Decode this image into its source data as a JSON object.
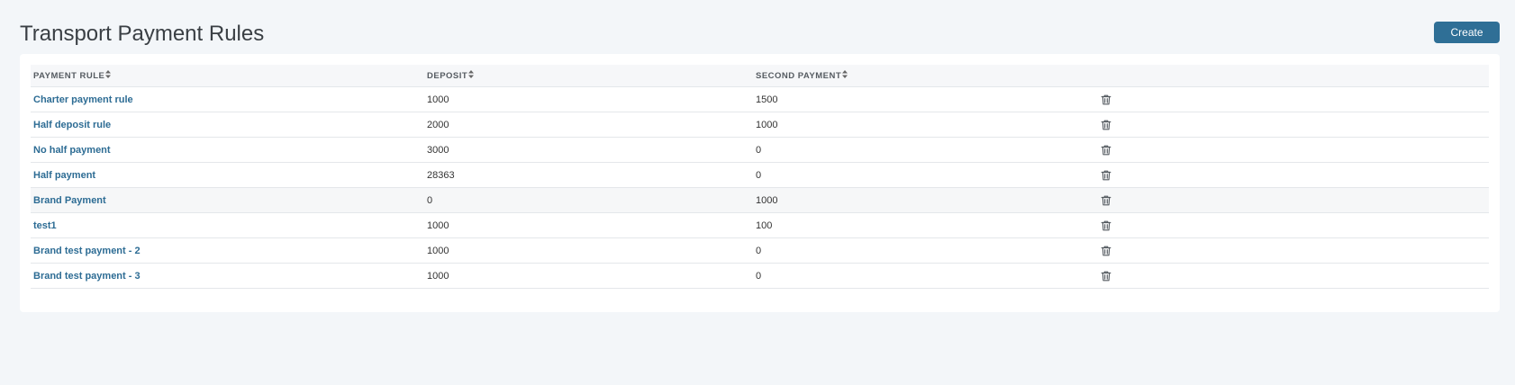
{
  "page": {
    "title": "Transport Payment Rules",
    "create_label": "Create"
  },
  "table": {
    "headers": {
      "payment_rule": "PAYMENT RULE",
      "deposit": "DEPOSIT",
      "second_payment": "SECOND PAYMENT"
    },
    "sort_icon": "sort-icon",
    "delete_icon": "trash-icon",
    "highlighted_row_index": 4,
    "rows": [
      {
        "name": "Charter payment rule",
        "deposit": "1000",
        "second_payment": "1500"
      },
      {
        "name": "Half deposit rule",
        "deposit": "2000",
        "second_payment": "1000"
      },
      {
        "name": "No half payment",
        "deposit": "3000",
        "second_payment": "0"
      },
      {
        "name": "Half payment",
        "deposit": "28363",
        "second_payment": "0"
      },
      {
        "name": "Brand Payment",
        "deposit": "0",
        "second_payment": "1000"
      },
      {
        "name": "test1",
        "deposit": "1000",
        "second_payment": "100"
      },
      {
        "name": "Brand test payment - 2",
        "deposit": "1000",
        "second_payment": "0"
      },
      {
        "name": "Brand test payment - 3",
        "deposit": "1000",
        "second_payment": "0"
      }
    ]
  },
  "colors": {
    "background": "#f3f6f9",
    "accent": "#2f6f96",
    "link": "#2d6c94"
  }
}
